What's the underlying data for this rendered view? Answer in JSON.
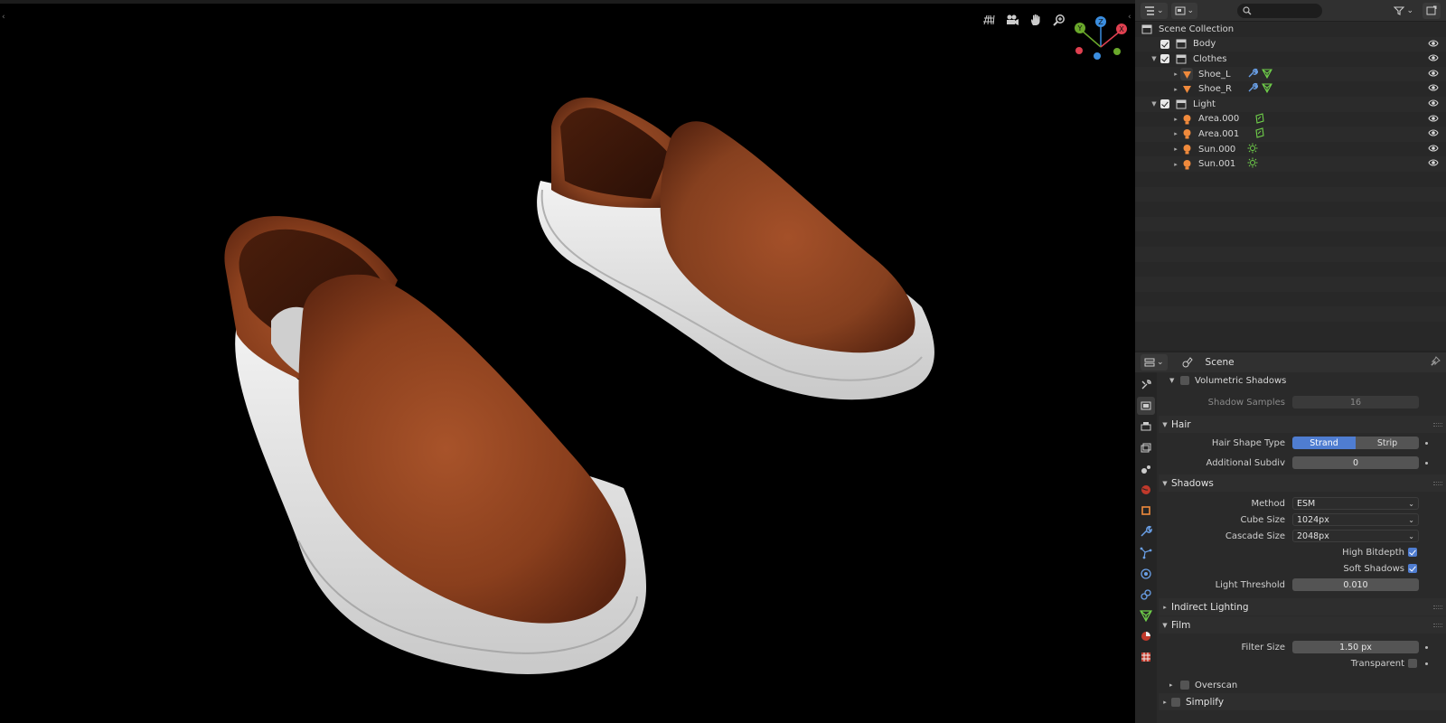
{
  "colors": {
    "accent": "#4f7dd1",
    "leather": "#8a3f1d",
    "sole": "#e6e6e6",
    "axis_x": "#e04050",
    "axis_y": "#6aa82b",
    "axis_z": "#3b8ee0"
  },
  "viewport": {
    "edge_left": "‹",
    "edge_right": "‹",
    "nav_icons": [
      "grid-icon",
      "camera-icon",
      "hand-icon",
      "zoom-icon"
    ],
    "gizmo": {
      "x": "X",
      "y": "Y",
      "z": "Z"
    }
  },
  "outliner": {
    "search_placeholder": "",
    "rows": [
      {
        "label": "Scene Collection"
      },
      {
        "label": "Body"
      },
      {
        "label": "Clothes"
      },
      {
        "label": "Shoe_L"
      },
      {
        "label": "Shoe_R"
      },
      {
        "label": "Light"
      },
      {
        "label": "Area.000"
      },
      {
        "label": "Area.001"
      },
      {
        "label": "Sun.000"
      },
      {
        "label": "Sun.001"
      }
    ]
  },
  "properties": {
    "title": "Scene",
    "volumetric_shadows": "Volumetric Shadows",
    "shadow_samples": {
      "label": "Shadow Samples",
      "value": "16"
    },
    "hair": {
      "title": "Hair",
      "shape_type": {
        "label": "Hair Shape Type",
        "options": [
          "Strand",
          "Strip"
        ]
      },
      "additional_subdiv": {
        "label": "Additional Subdiv",
        "value": "0"
      }
    },
    "shadows": {
      "title": "Shadows",
      "method": {
        "label": "Method",
        "value": "ESM"
      },
      "cube_size": {
        "label": "Cube Size",
        "value": "1024px"
      },
      "cascade_size": {
        "label": "Cascade Size",
        "value": "2048px"
      },
      "high_bitdepth": {
        "label": "High Bitdepth",
        "checked": true
      },
      "soft_shadows": {
        "label": "Soft Shadows",
        "checked": true
      },
      "light_threshold": {
        "label": "Light Threshold",
        "value": "0.010"
      }
    },
    "indirect_lighting": {
      "title": "Indirect Lighting"
    },
    "film": {
      "title": "Film",
      "filter_size": {
        "label": "Filter Size",
        "value": "1.50 px"
      },
      "transparent": {
        "label": "Transparent",
        "checked": false
      }
    },
    "overscan": "Overscan",
    "simplify": "Simplify"
  }
}
